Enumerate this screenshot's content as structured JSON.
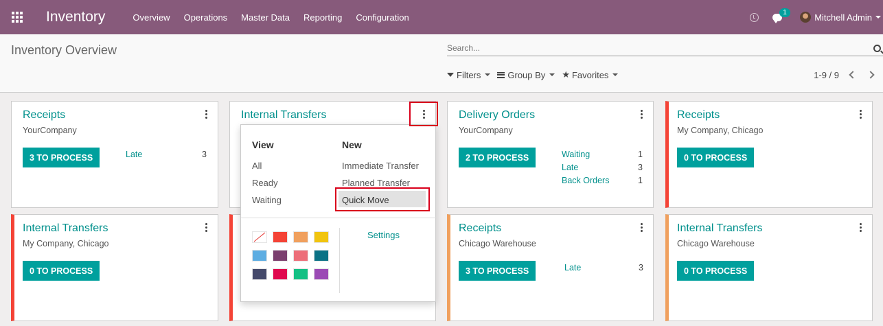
{
  "nav": {
    "brand": "Inventory",
    "menu": [
      "Overview",
      "Operations",
      "Master Data",
      "Reporting",
      "Configuration"
    ],
    "chat_count": "1",
    "user": "Mitchell Admin"
  },
  "control": {
    "title": "Inventory Overview",
    "search_placeholder": "Search...",
    "filters": "Filters",
    "group_by": "Group By",
    "favorites": "Favorites",
    "pager": "1-9 / 9"
  },
  "cards": [
    {
      "title": "Receipts",
      "subtitle": "YourCompany",
      "button": "3 TO PROCESS",
      "stats": [
        {
          "label": "Late",
          "value": "3"
        }
      ]
    },
    {
      "title": "Internal Transfers"
    },
    {
      "title": "Delivery Orders",
      "subtitle": "YourCompany",
      "button": "2 TO PROCESS",
      "stats": [
        {
          "label": "Waiting",
          "value": "1"
        },
        {
          "label": "Late",
          "value": "3"
        },
        {
          "label": "Back Orders",
          "value": "1"
        }
      ]
    },
    {
      "title": "Receipts",
      "subtitle": "My Company, Chicago",
      "button": "0 TO PROCESS"
    },
    {
      "title": "Internal Transfers",
      "subtitle": "My Company, Chicago",
      "button": "0 TO PROCESS"
    },
    {
      "title": "Receipts",
      "subtitle": "Chicago Warehouse",
      "button": "3 TO PROCESS",
      "stats": [
        {
          "label": "Late",
          "value": "3"
        }
      ]
    },
    {
      "title": "Internal Transfers",
      "subtitle": "Chicago Warehouse",
      "button": "0 TO PROCESS"
    }
  ],
  "dropdown": {
    "view_header": "View",
    "view_items": [
      "All",
      "Ready",
      "Waiting"
    ],
    "new_header": "New",
    "new_items": [
      "Immediate Transfer",
      "Planned Transfer",
      "Quick Move"
    ],
    "settings": "Settings",
    "colors": [
      "#ffffff",
      "#f44336",
      "#f0a05e",
      "#f1c40f",
      "#5dade2",
      "#7b3f6e",
      "#ed6e79",
      "#0b7285",
      "#454a6b",
      "#e0094f",
      "#14c084",
      "#9b4ab5"
    ]
  }
}
